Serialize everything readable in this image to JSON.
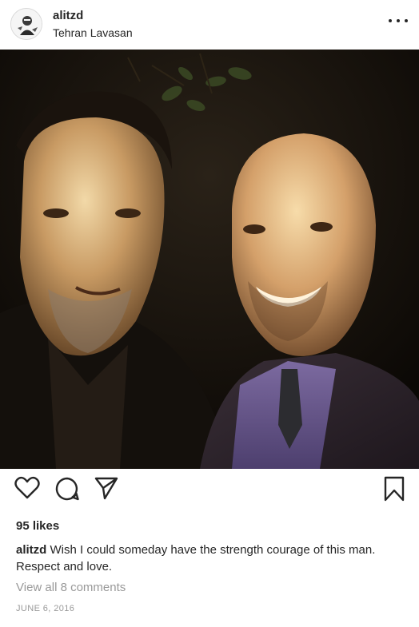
{
  "header": {
    "username": "alitzd",
    "location": "Tehran Lavasan",
    "avatar_icon": "profile-avatar",
    "more_icon": "more-horizontal-icon"
  },
  "photo": {
    "description_icon": "selfie-photo"
  },
  "actions": {
    "like_icon": "heart-icon",
    "comment_icon": "comment-icon",
    "share_icon": "share-icon",
    "save_icon": "bookmark-icon"
  },
  "likes": {
    "text": "95 likes"
  },
  "caption": {
    "username": "alitzd",
    "text": "Wish I could someday have the strength courage of this man. Respect and love."
  },
  "comments": {
    "link_text": "View all 8 comments"
  },
  "date": {
    "text": "JUNE 6, 2016"
  },
  "colors": {
    "text": "#262626",
    "muted": "#999999",
    "background": "#ffffff"
  }
}
